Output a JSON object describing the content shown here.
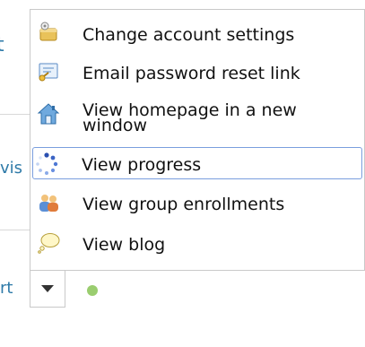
{
  "background": {
    "fragment_top": "t",
    "fragment_middle": "vis",
    "fragment_bottom": "rt"
  },
  "menu": {
    "items": [
      {
        "label": "Change account settings",
        "icon": "settings-icon"
      },
      {
        "label": "Email password reset link",
        "icon": "email-reset-icon"
      },
      {
        "label": "View homepage in a new window",
        "icon": "homepage-icon"
      },
      {
        "label": "View progress",
        "icon": "progress-icon",
        "selected": true
      },
      {
        "label": "View group enrollments",
        "icon": "group-icon"
      },
      {
        "label": "View blog",
        "icon": "blog-icon"
      }
    ]
  },
  "colors": {
    "status_dot": "#9acd6f",
    "selection_border": "#7a9ede",
    "link_text": "#2e7aa8"
  }
}
